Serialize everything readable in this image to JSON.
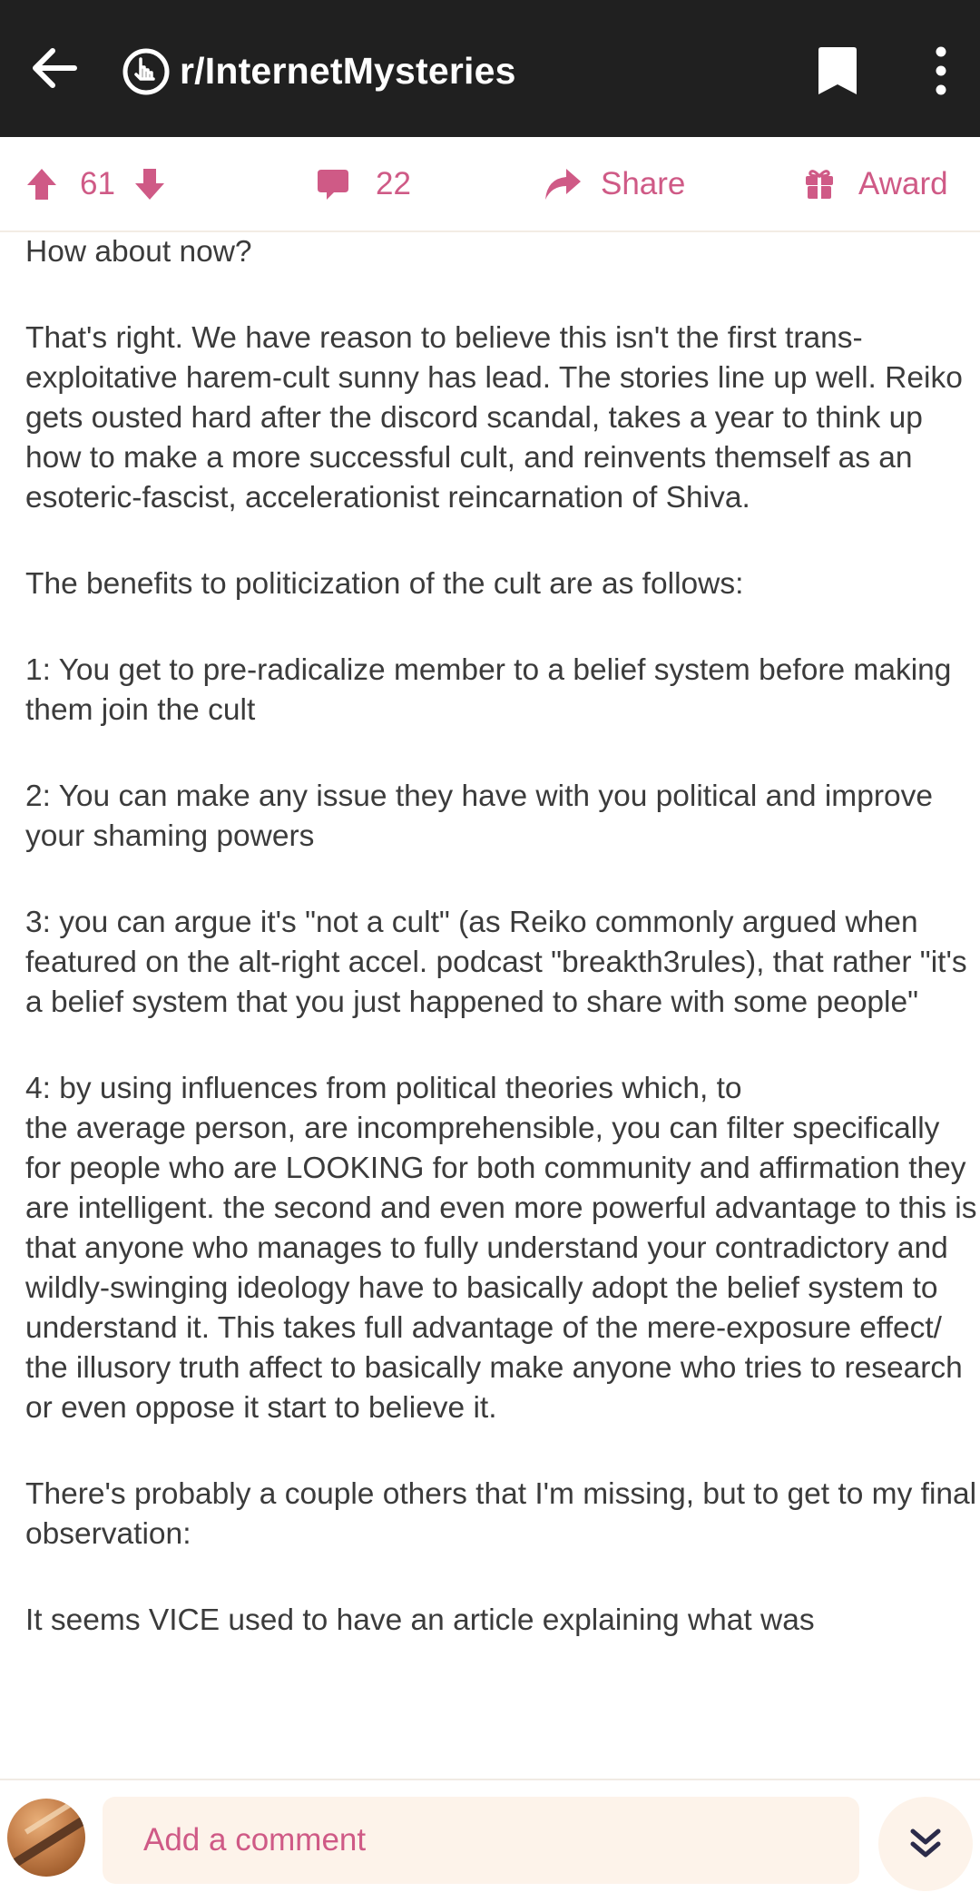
{
  "header": {
    "back_icon": "arrow-left-icon",
    "subreddit_icon": "reddit-community-icon",
    "title": "r/InternetMysteries",
    "bookmark_icon": "bookmark-icon",
    "more_icon": "more-vertical-icon"
  },
  "actions": {
    "upvotes": "61",
    "comments": "22",
    "share_label": "Share",
    "award_label": "Award",
    "accent_color": "#cf5a86"
  },
  "post": {
    "paragraphs": [
      "How about now?",
      "That's right. We have reason to believe this isn't the first trans-exploitative harem-cult sunny has lead. The stories line up well. Reiko gets ousted hard after the discord scandal, takes a year to think up how to make a more successful cult, and reinvents themself as an esoteric-fascist, accelerationist reincarnation of Shiva.",
      "The benefits to politicization of the cult are as follows:",
      "1: You get to pre-radicalize member to a belief system before making them join the cult",
      "2: You can make any issue they have with you political and improve your shaming powers",
      "3: you can argue it's \"not a cult\" (as Reiko commonly argued when featured on the alt-right accel. podcast \"breakth3rules), that rather \"it's a belief system that you just happened to share with some people\"",
      "4: by using influences from political theories which, to\nthe average person, are incomprehensible, you can filter specifically for people who are LOOKING for both community and affirmation they are intelligent. the second and even more powerful advantage to this is that anyone who manages to fully understand your contradictory and wildly-swinging ideology have to basically adopt the belief system to understand it. This takes full advantage of the mere-exposure effect/ the illusory truth affect to basically make anyone who tries to research or even oppose it  start to believe it.",
      "There's probably a couple others that I'm missing, but to get to my final observation:",
      "It seems VICE used to have an article explaining what was"
    ]
  },
  "footer": {
    "comment_placeholder": "Add a comment",
    "scroll_icon": "chevron-double-down-icon"
  }
}
